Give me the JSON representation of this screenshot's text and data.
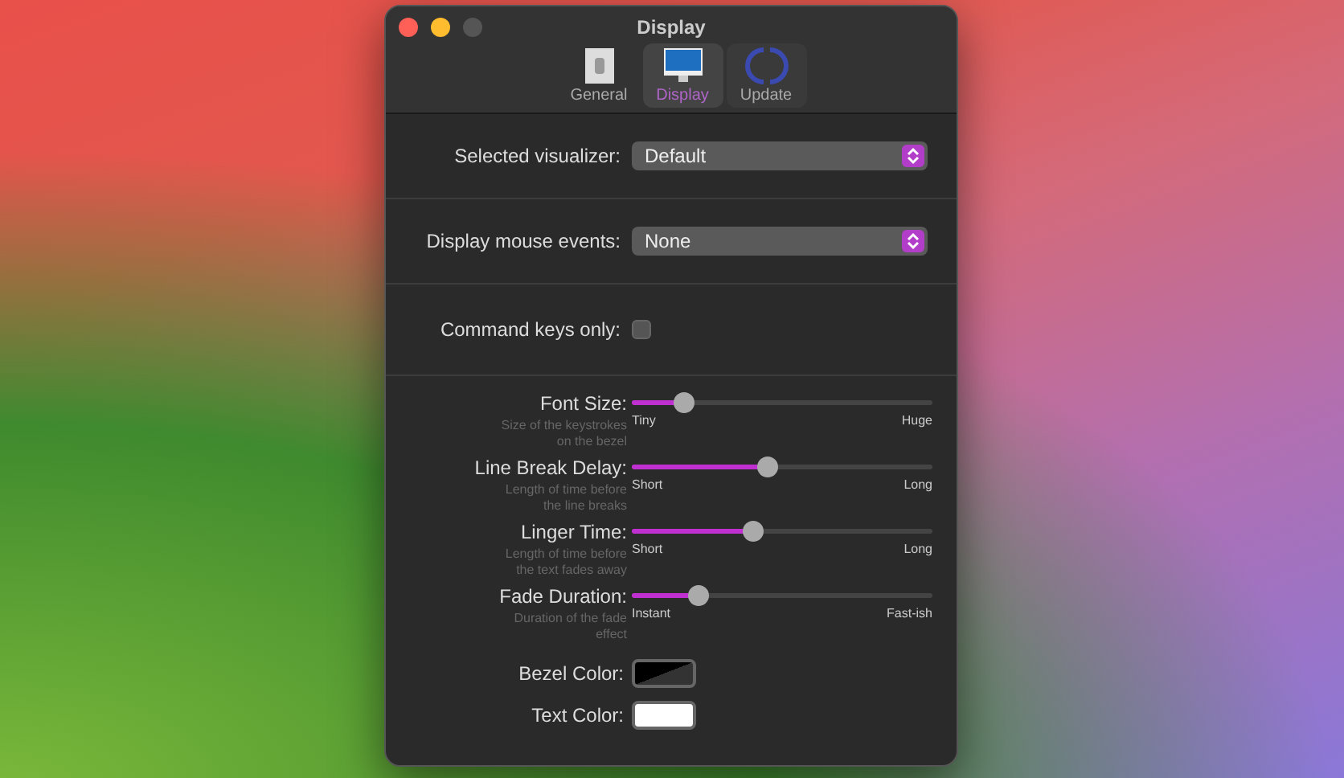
{
  "window": {
    "title": "Display"
  },
  "toolbar": [
    {
      "label": "General",
      "kind": "general",
      "selected": false
    },
    {
      "label": "Display",
      "kind": "display",
      "selected": true
    },
    {
      "label": "Update",
      "kind": "update",
      "selected": false
    }
  ],
  "popups": [
    {
      "label": "Selected visualizer:",
      "value": "Default"
    },
    {
      "label": "Display mouse events:",
      "value": "None"
    }
  ],
  "command_keys_only": {
    "label": "Command keys only:",
    "checked": false
  },
  "sliders": [
    {
      "label": "Font Size:",
      "hint": "Size of the keystrokes on the bezel",
      "min_label": "Tiny",
      "max_label": "Huge",
      "level": 0.17
    },
    {
      "label": "Line Break Delay:",
      "hint": "Length of time before the line breaks",
      "min_label": "Short",
      "max_label": "Long",
      "level": 0.45
    },
    {
      "label": "Linger Time:",
      "hint": "Length of time before the text fades away",
      "min_label": "Short",
      "max_label": "Long",
      "level": 0.4
    },
    {
      "label": "Fade Duration:",
      "hint": "Duration of the fade effect",
      "min_label": "Instant",
      "max_label": "Fast-ish",
      "level": 0.22
    }
  ],
  "color_wells": [
    {
      "label": "Bezel Color:",
      "color": "#000000"
    },
    {
      "label": "Text Color:",
      "color": "#ffffff"
    }
  ]
}
